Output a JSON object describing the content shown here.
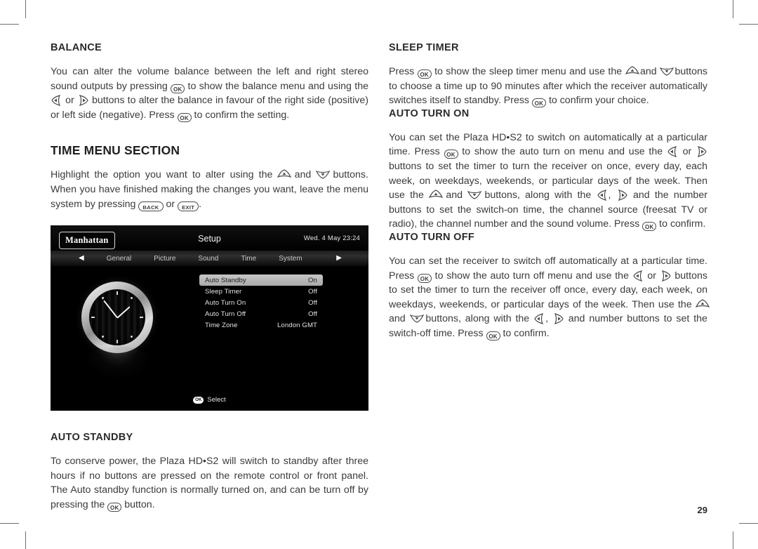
{
  "page": {
    "number": "29"
  },
  "left_column": {
    "balance": {
      "heading": "BALANCE",
      "para_1": "You can alter the volume balance between the left and right stereo sound outputs by pressing",
      "para_2": "to show the balance menu and using the",
      "para_3": "or",
      "para_4": "buttons to alter the balance in favour of the right side (positive) or left side (negative). Press",
      "para_5": "to confirm the setting."
    },
    "time_menu": {
      "heading": "TIME MENU SECTION",
      "para_1": "Highlight the option you want to alter using the",
      "para_2": "and",
      "para_3": "buttons. When you have finished making the changes you want, leave the menu system by pressing",
      "para_4": "or",
      "para_5": "."
    },
    "auto_standby": {
      "heading": "AUTO STANDBY",
      "para_1": "To conserve power, the Plaza HD•S2 will switch to standby after three hours if no buttons are pressed on the remote control or front panel. The Auto standby function is normally turned on, and can be turn off by pressing the",
      "para_2": "button."
    }
  },
  "right_column": {
    "sleep_timer": {
      "heading": "SLEEP TIMER",
      "para_1": "Press",
      "para_2": "to show the sleep timer menu and use the",
      "para_3": "and",
      "para_4": "buttons to choose a time up to 90 minutes after which the receiver automatically switches itself to standby. Press",
      "para_5": "to confirm your choice."
    },
    "auto_turn_on": {
      "heading": "AUTO TURN ON",
      "para_1": "You can set the Plaza HD•S2 to switch on automatically at a particular time. Press",
      "para_2": "to show the auto turn on menu and use the",
      "para_3": "or",
      "para_4": "buttons to set the timer to turn the receiver on once, every day, each week, on weekdays, weekends, or particular days of the week. Then use the",
      "para_5": "and",
      "para_6": "buttons, along with the",
      "para_7": ",",
      "para_8": "and the number buttons to set the switch-on time, the channel source (freesat TV or radio), the channel number and the sound volume. Press",
      "para_9": "to confirm."
    },
    "auto_turn_off": {
      "heading": "AUTO TURN OFF",
      "para_1": "You can set the receiver to switch off automatically at a particular time. Press",
      "para_2": "to show the auto turn off menu and use the",
      "para_3": "or",
      "para_4": "buttons to set the timer to turn the receiver off once, every day, each week, on weekdays, weekends, or particular days of the week. Then use the",
      "para_5": "and",
      "para_6": "buttons, along with the",
      "para_7": ",",
      "para_8": "and number buttons to set the switch-off time.  Press",
      "para_9": "to confirm."
    }
  },
  "buttons": {
    "ok": "OK",
    "back": "BACK",
    "exit": "EXIT"
  },
  "tv_screen": {
    "brand": "Manhattan",
    "title": "Setup",
    "datetime": "Wed. 4 May  23:24",
    "nav": {
      "left_arrow": "◀",
      "right_arrow": "▶",
      "items": [
        "General",
        "Picture",
        "Sound",
        "Time",
        "System"
      ]
    },
    "settings": [
      {
        "label": "Auto Standby",
        "value": "On",
        "highlighted": true
      },
      {
        "label": "Sleep Timer",
        "value": "Off",
        "highlighted": false
      },
      {
        "label": "Auto Turn On",
        "value": "Off",
        "highlighted": false
      },
      {
        "label": "Auto Turn Off",
        "value": "Off",
        "highlighted": false
      },
      {
        "label": "Time Zone",
        "value": "London GMT",
        "highlighted": false
      }
    ],
    "footer": {
      "ok_chip": "OK",
      "label": "Select"
    }
  },
  "colors": {
    "text": "#3b3b3d",
    "heading": "#2b2b2d",
    "screen_bg": "#000000",
    "highlight_row": "#b5b5b5",
    "crop_mark": "#6e6f71"
  }
}
